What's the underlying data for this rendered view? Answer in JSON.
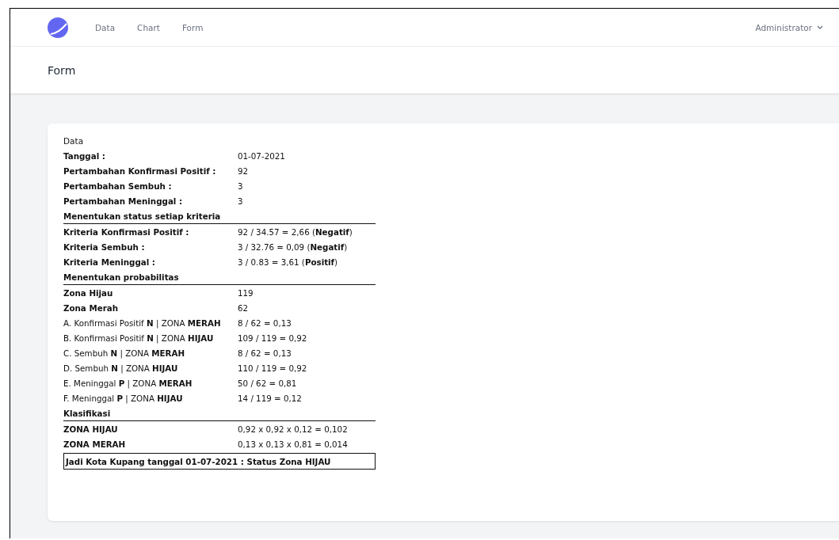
{
  "navbar": {
    "links": [
      {
        "label": "Data"
      },
      {
        "label": "Chart"
      },
      {
        "label": "Form"
      }
    ],
    "user": "Administrator"
  },
  "page_title": "Form",
  "card": {
    "title": "Data",
    "rows": [
      {
        "kind": "field",
        "label": "Tanggal :",
        "value": "01-07-2021"
      },
      {
        "kind": "field",
        "label": "Pertambahan Konfirmasi Positif :",
        "value": "92"
      },
      {
        "kind": "field",
        "label": "Pertambahan Sembuh :",
        "value": "3"
      },
      {
        "kind": "field",
        "label": "Pertambahan Meninggal :",
        "value": "3"
      },
      {
        "kind": "section",
        "label": "Menentukan status setiap kriteria"
      },
      {
        "kind": "field",
        "label": "Kriteria Konfirmasi Positif :",
        "value": "92 / 34.57 = 2,66 (**Negatif**)"
      },
      {
        "kind": "field",
        "label": "Kriteria Sembuh :",
        "value": "3 / 32.76 = 0,09 (**Negatif**)"
      },
      {
        "kind": "field",
        "label": "Kriteria Meninggal :",
        "value": "3 / 0.83 = 3,61 (**Positif**)"
      },
      {
        "kind": "section",
        "label": "Menentukan probabilitas"
      },
      {
        "kind": "field",
        "label": "Zona Hijau",
        "value": "119"
      },
      {
        "kind": "field",
        "label": "Zona Merah",
        "value": "62"
      },
      {
        "kind": "prob",
        "label": "A. Konfirmasi Positif **N** | ZONA **MERAH**",
        "value": "8 / 62 = 0,13"
      },
      {
        "kind": "prob",
        "label": "B. Konfirmasi Positif **N** | ZONA **HIJAU**",
        "value": "109 / 119 = 0,92"
      },
      {
        "kind": "prob",
        "label": "C. Sembuh **N** | ZONA **MERAH**",
        "value": "8 / 62 = 0,13"
      },
      {
        "kind": "prob",
        "label": "D. Sembuh **N** | ZONA **HIJAU**",
        "value": "110 / 119 = 0,92"
      },
      {
        "kind": "prob",
        "label": "E. Meninggal **P** | ZONA **MERAH**",
        "value": "50 / 62 = 0,81"
      },
      {
        "kind": "prob",
        "label": "F. Meninggal **P** | ZONA **HIJAU**",
        "value": "14 / 119 = 0,12"
      },
      {
        "kind": "section",
        "label": "Klasifikasi"
      },
      {
        "kind": "field",
        "label": "ZONA HIJAU",
        "value": "0,92 x 0,92 x 0,12 = 0,102"
      },
      {
        "kind": "field",
        "label": "ZONA MERAH",
        "value": "0,13 x 0,13 x 0,81 = 0,014"
      },
      {
        "kind": "result",
        "label": "Jadi Kota Kupang tanggal 01-07-2021 : Status Zona HIJAU"
      }
    ]
  }
}
